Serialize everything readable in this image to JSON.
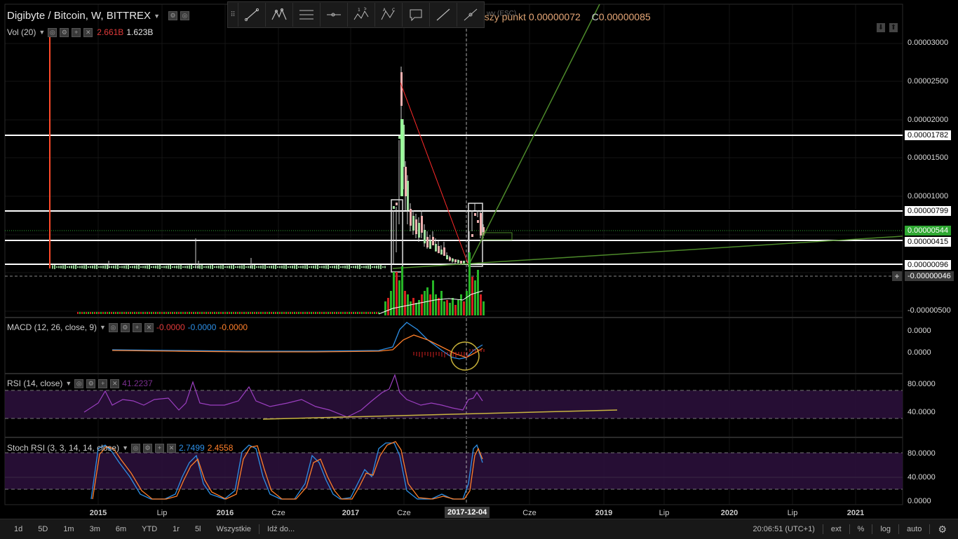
{
  "header": {
    "symbol_title": "Digibyte / Bitcoin, W, BITTREX",
    "tooltip_text": "miszy punkt",
    "low_value": "0.00000072",
    "close_prefix": "C",
    "close_value": "0.00000085",
    "escape_hint": "wy (ESC)"
  },
  "volume_legend": {
    "label": "Vol (20)",
    "value1": "2.661B",
    "value2": "1.623B"
  },
  "macd_legend": {
    "label": "MACD (12, 26, close, 9)",
    "v1": "-0.0000",
    "v2": "-0.0000",
    "v3": "-0.0000"
  },
  "rsi_legend": {
    "label": "RSI (14, close)",
    "value": "41.2237"
  },
  "stoch_legend": {
    "label": "Stoch RSI (3, 3, 14, 14, close)",
    "v1": "2.7499",
    "v2": "2.4558"
  },
  "price_axis": {
    "ticks": [
      "0.00003000",
      "0.00002500",
      "0.00002000",
      "0.00001500",
      "0.00001000",
      "-0.00000500"
    ],
    "tags": [
      {
        "text": "0.00001782",
        "bg": "#ffffff",
        "fg": "#000000"
      },
      {
        "text": "0.00000799",
        "bg": "#ffffff",
        "fg": "#000000"
      },
      {
        "text": "0.00000544",
        "bg": "#2fa832",
        "fg": "#ffffff"
      },
      {
        "text": "0.00000415",
        "bg": "#ffffff",
        "fg": "#000000"
      },
      {
        "text": "0.00000096",
        "bg": "#ffffff",
        "fg": "#000000"
      },
      {
        "text": "-0.00000046",
        "bg": "#3a3a3a",
        "fg": "#ffffff"
      }
    ]
  },
  "macd_axis": {
    "ticks": [
      "0.0000",
      "0.0000"
    ]
  },
  "rsi_axis": {
    "ticks": [
      "80.0000",
      "40.0000"
    ]
  },
  "stoch_axis": {
    "ticks": [
      "80.0000",
      "40.0000",
      "0.0000"
    ]
  },
  "time_axis": {
    "labels": [
      "2015",
      "Lip",
      "2016",
      "Cze",
      "2017",
      "Cze",
      "Cze",
      "2019",
      "Lip",
      "2020",
      "Lip",
      "2021"
    ],
    "crosshair_date": "2017-12-04"
  },
  "bottom_bar": {
    "ranges": [
      "1d",
      "5D",
      "1m",
      "3m",
      "6m",
      "YTD",
      "1r",
      "5l",
      "Wszystkie"
    ],
    "goto": "Idź do...",
    "clock": "20:06:51 (UTC+1)",
    "ext": "ext",
    "percent": "%",
    "log": "log",
    "auto": "auto"
  },
  "toolbar": {
    "tools": [
      "trend-line-icon",
      "pitchfork-icon",
      "fib-retracement-icon",
      "horizontal-ray-icon",
      "pattern-15-icon",
      "abcd-pattern-icon",
      "callout-icon",
      "line-icon",
      "path-icon"
    ]
  },
  "colors": {
    "up": "#26b526",
    "down": "#d42020",
    "macd_line": "#2d8fe6",
    "signal_line": "#ff7f2a",
    "rsi_line": "#9b3fc0",
    "rsi_band": "#2a0f3a",
    "stoch_k": "#2d8fe6",
    "stoch_d": "#ff7f2a",
    "trend_green": "#4d8a2a",
    "trend_red": "#ff2a2a",
    "trend_yellow": "#c8b440"
  }
}
